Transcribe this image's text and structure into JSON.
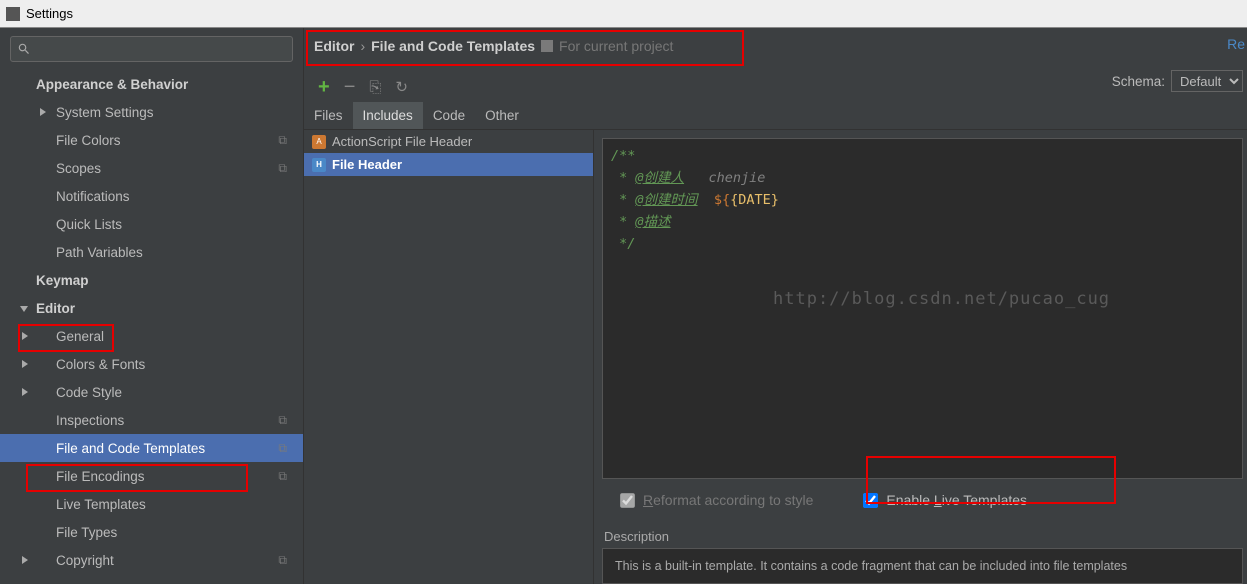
{
  "window": {
    "title": "Settings"
  },
  "sidebar": {
    "items": [
      {
        "label": "Appearance & Behavior",
        "type": "group",
        "arrow": false
      },
      {
        "label": "System Settings",
        "type": "sub",
        "arrow": "right"
      },
      {
        "label": "File Colors",
        "type": "sub",
        "copy": true
      },
      {
        "label": "Scopes",
        "type": "sub",
        "copy": true
      },
      {
        "label": "Notifications",
        "type": "sub"
      },
      {
        "label": "Quick Lists",
        "type": "sub"
      },
      {
        "label": "Path Variables",
        "type": "sub"
      },
      {
        "label": "Keymap",
        "type": "group"
      },
      {
        "label": "Editor",
        "type": "group",
        "arrow": "down"
      },
      {
        "label": "General",
        "type": "subsub",
        "arrow": "right"
      },
      {
        "label": "Colors & Fonts",
        "type": "subsub",
        "arrow": "right"
      },
      {
        "label": "Code Style",
        "type": "subsub",
        "arrow": "right"
      },
      {
        "label": "Inspections",
        "type": "subsub",
        "copy": true
      },
      {
        "label": "File and Code Templates",
        "type": "subsub",
        "copy": true,
        "selected": true
      },
      {
        "label": "File Encodings",
        "type": "subsub",
        "copy": true
      },
      {
        "label": "Live Templates",
        "type": "subsub"
      },
      {
        "label": "File Types",
        "type": "subsub"
      },
      {
        "label": "Copyright",
        "type": "subsub",
        "arrow": "right",
        "copy": true
      }
    ]
  },
  "breadcrumb": {
    "part1": "Editor",
    "sep": "›",
    "part2": "File and Code Templates",
    "hint": "For current project"
  },
  "reset_label": "Re",
  "schema": {
    "label": "Schema:",
    "value": "Default"
  },
  "tabs": [
    "Files",
    "Includes",
    "Code",
    "Other"
  ],
  "active_tab": 1,
  "list": [
    {
      "label": "ActionScript File Header",
      "icon": "AS"
    },
    {
      "label": "File Header",
      "icon": "H",
      "selected": true
    }
  ],
  "code": {
    "l1": "/**",
    "l2_tag": "@创建人",
    "l2_val": "chenjie",
    "l3_tag": "@创建时间",
    "l3_var": "${",
    "l3_name": "DATE",
    "l3_close": "}",
    "l4_tag": "@描述",
    "l5": "*/"
  },
  "watermark": "http://blog.csdn.net/pucao_cug",
  "options": {
    "reformat": "Reformat according to style",
    "live": "Enable ",
    "live_u": "L",
    "live_rest": "ive Templates"
  },
  "desc": {
    "label": "Description",
    "text": "This is a built-in template. It contains a code fragment that can be included into file templates"
  }
}
